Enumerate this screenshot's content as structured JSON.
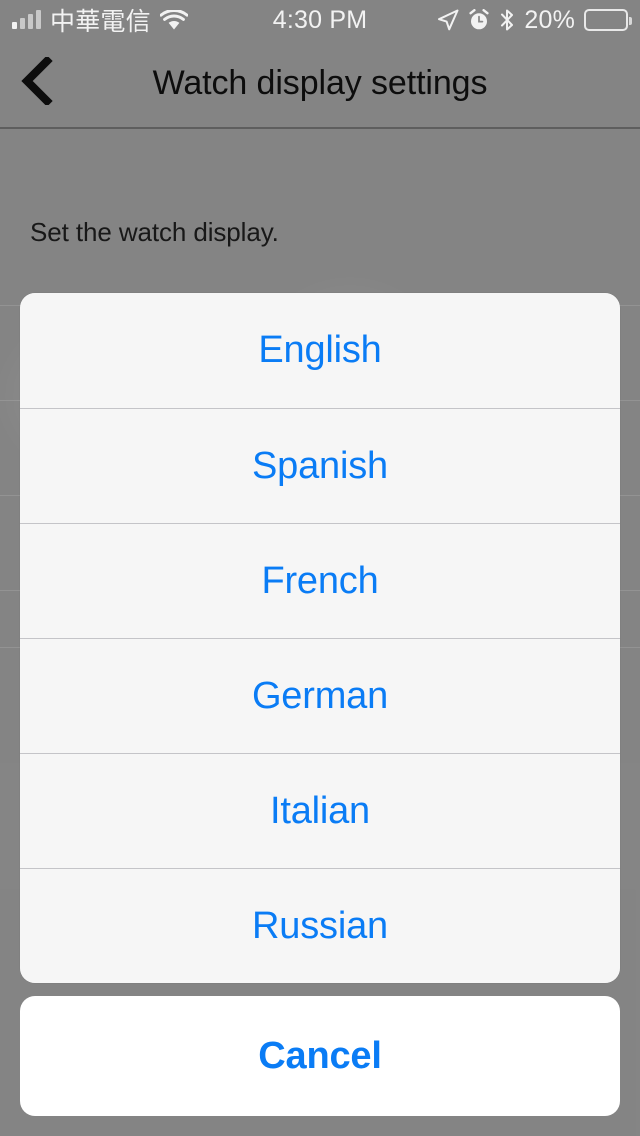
{
  "status_bar": {
    "carrier": "中華電信",
    "time": "4:30 PM",
    "battery_percent": "20%",
    "battery_level": 20,
    "signal_bars_filled": 1,
    "signal_bars_total": 4,
    "icons": {
      "wifi": "wifi-icon",
      "location": "location-arrow-icon",
      "alarm": "alarm-clock-icon",
      "bluetooth": "bluetooth-icon",
      "battery": "battery-icon"
    },
    "colors": {
      "text": "#f2f2f2",
      "battery_fill": "#f5c518"
    }
  },
  "nav_bar": {
    "back_icon": "chevron-left-icon",
    "title": "Watch display settings"
  },
  "content": {
    "description": "Set the watch display."
  },
  "action_sheet": {
    "options": [
      {
        "label": "English"
      },
      {
        "label": "Spanish"
      },
      {
        "label": "French"
      },
      {
        "label": "German"
      },
      {
        "label": "Italian"
      },
      {
        "label": "Russian"
      }
    ],
    "cancel_label": "Cancel",
    "colors": {
      "tint": "#0a7cf5",
      "sheet_background": "#f9f9f9",
      "cancel_background": "#ffffff",
      "screen_dim": "#8a8a8a"
    }
  }
}
